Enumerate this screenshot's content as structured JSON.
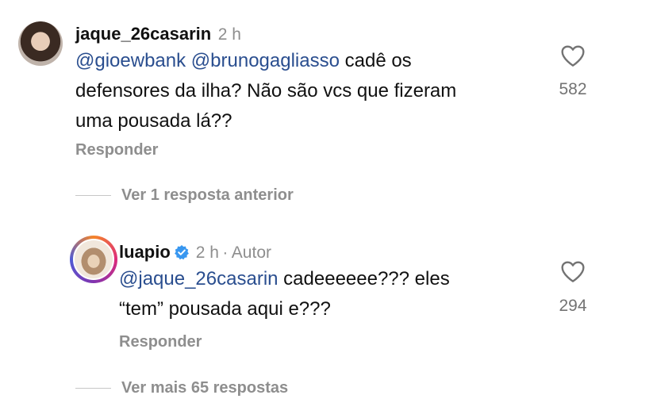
{
  "comments": [
    {
      "username": "jaque_26casarin",
      "time": "2 h",
      "mentions": [
        "@gioewbank",
        "@brunogagliasso"
      ],
      "text_after_mentions": "cadê os",
      "line2": "defensores da ilha? Não são vcs que fizeram",
      "line3": "uma pousada lá??",
      "likes": "582",
      "reply_label": "Responder",
      "icon": "heart-outline-icon"
    },
    {
      "username": "luapio",
      "time": "2 h",
      "author_tag": "Autor",
      "mention": "@jaque_26casarin",
      "text_after_mention": "cadeeeeee??? eles",
      "line2": "“tem” pousada aqui e???",
      "likes": "294",
      "reply_label": "Responder",
      "verified": true,
      "icon": "heart-outline-icon"
    }
  ],
  "threads": {
    "view_previous": "Ver 1 resposta anterior",
    "view_more": "Ver mais 65 respostas"
  },
  "colors": {
    "mention": "#2a4e8f",
    "muted": "#8e8e8e",
    "verified": "#3897f0"
  }
}
